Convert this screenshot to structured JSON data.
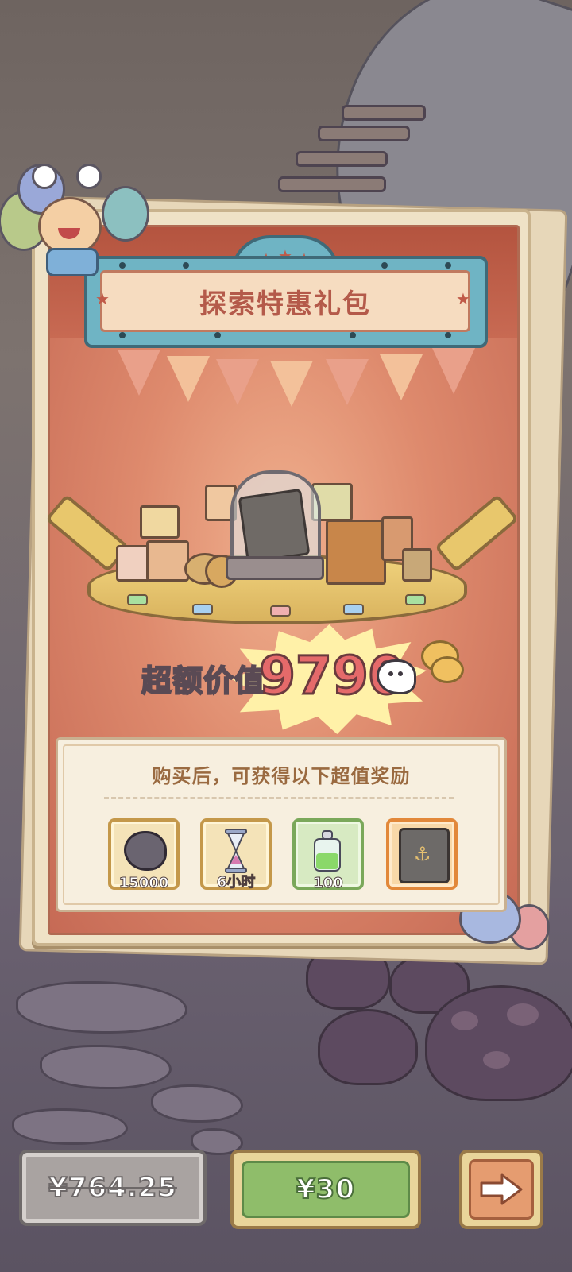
{
  "title": "探索特惠礼包",
  "value": {
    "label": "超额价值",
    "amount": "9790"
  },
  "rewards": {
    "heading": "购买后，可获得以下超值奖励",
    "items": [
      {
        "icon": "ghost-token-icon",
        "count": "15000"
      },
      {
        "icon": "hourglass-icon",
        "count": "6小时"
      },
      {
        "icon": "potion-bottle-icon",
        "count": "100"
      },
      {
        "icon": "anchor-book-icon",
        "count": ""
      }
    ]
  },
  "buttons": {
    "original_price": "¥764.25",
    "buy_price": "¥30",
    "next": "arrow-right-icon"
  },
  "colors": {
    "title_text": "#b45a4a",
    "value_number": "#e56a6a",
    "buy_button": "#8fbd6a",
    "next_button": "#e59c70"
  }
}
